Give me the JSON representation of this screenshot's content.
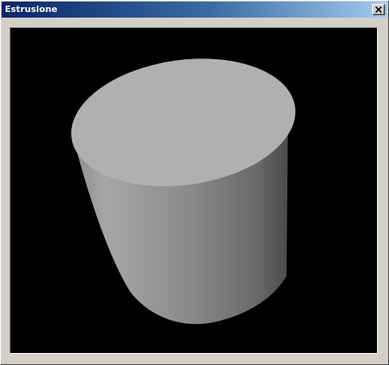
{
  "window": {
    "title": "Estrusione",
    "close_glyph": "close-icon"
  },
  "viewport": {
    "background_color": "#000000",
    "object": "cylinder",
    "object_top_color": "#b0b0b0",
    "object_side_light_color": "#a8a8a8",
    "object_side_dark_color": "#4a4a4a"
  }
}
